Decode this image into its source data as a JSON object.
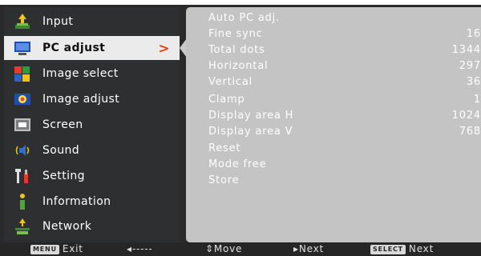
{
  "menu": {
    "items": [
      {
        "label": "Input",
        "icon": "input-icon"
      },
      {
        "label": "PC adjust",
        "icon": "pc-adjust-icon",
        "active": true
      },
      {
        "label": "Image select",
        "icon": "image-select-icon"
      },
      {
        "label": "Image adjust",
        "icon": "image-adjust-icon"
      },
      {
        "label": "Screen",
        "icon": "screen-icon"
      },
      {
        "label": "Sound",
        "icon": "sound-icon"
      },
      {
        "label": "Setting",
        "icon": "setting-icon"
      },
      {
        "label": "Information",
        "icon": "information-icon"
      },
      {
        "label": "Network",
        "icon": "network-icon"
      }
    ],
    "active_arrow": ">"
  },
  "panel": {
    "rows": [
      {
        "name": "Auto PC adj.",
        "value": ""
      },
      {
        "name": "Fine sync",
        "value": "16"
      },
      {
        "name": "Total dots",
        "value": "1344"
      },
      {
        "name": "Horizontal",
        "value": "297"
      },
      {
        "name": "Vertical",
        "value": "36"
      },
      {
        "name": "Clamp",
        "value": "1"
      },
      {
        "name": "Display area H",
        "value": "1024"
      },
      {
        "name": "Display area V",
        "value": "768"
      },
      {
        "name": "Reset",
        "value": ""
      },
      {
        "name": "Mode free",
        "value": ""
      },
      {
        "name": "Store",
        "value": ""
      }
    ]
  },
  "bottombar": {
    "menu_key": "MENU",
    "exit_label": "Exit",
    "back_label": "◂-----",
    "move_label": "⇕Move",
    "next_label": "▸Next",
    "select_key": "SELECT",
    "select_next_label": "Next"
  },
  "colors": {
    "menu_bg": "#2e2f31",
    "panel_bg": "#c4c4c4",
    "active_bg": "#ebebeb",
    "arrow": "#e8431b"
  }
}
